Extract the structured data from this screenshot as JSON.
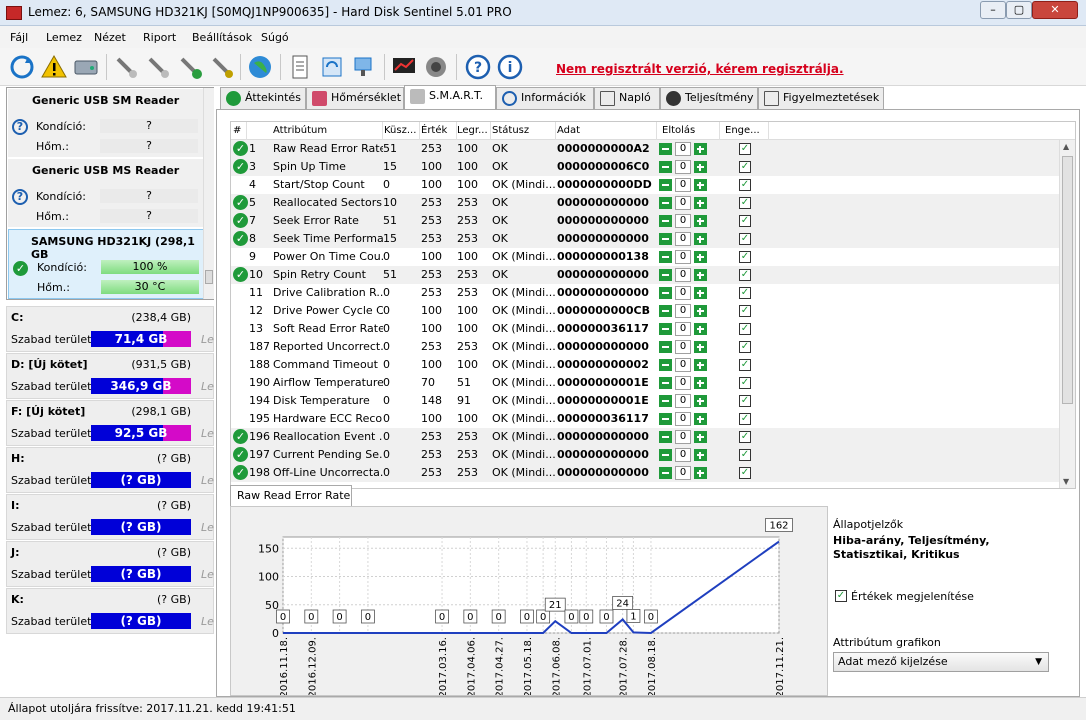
{
  "window": {
    "title": "Lemez: 6, SAMSUNG HD321KJ [S0MQJ1NP900635]  -  Hard Disk Sentinel 5.01 PRO",
    "min": "–",
    "max": "▢",
    "close": "✕"
  },
  "menu": [
    "Fájl",
    "Lemez",
    "Nézet",
    "Riport",
    "Beállítások",
    "Súgó"
  ],
  "register_link": "Nem regisztrált verzió, kérem regisztrálja.",
  "devices": [
    {
      "name": "Generic USB SM Reader",
      "condition_label": "Kondíció:",
      "condition": "?",
      "temp_label": "Hőm.:",
      "temp": "?"
    },
    {
      "name": "Generic USB MS Reader",
      "condition_label": "Kondíció:",
      "condition": "?",
      "temp_label": "Hőm.:",
      "temp": "?"
    },
    {
      "name": "SAMSUNG HD321KJ (298,1 GB",
      "condition_label": "Kondíció:",
      "condition": "100 %",
      "temp_label": "Hőm.:",
      "temp": "30 °C"
    }
  ],
  "partitions": [
    {
      "name": "C:",
      "size": "(238,4 GB)",
      "free_label": "Szabad terület",
      "free": "71,4 GB",
      "le": "Le"
    },
    {
      "name": "D: [Új kötet]",
      "size": "(931,5 GB)",
      "free_label": "Szabad terület",
      "free": "346,9 GB",
      "le": "Le"
    },
    {
      "name": "F: [Új kötet]",
      "size": "(298,1 GB)",
      "free_label": "Szabad terület",
      "free": "92,5 GB",
      "le": "Le"
    },
    {
      "name": "H:",
      "size": "(? GB)",
      "free_label": "Szabad terület",
      "free": "(? GB)",
      "le": "Le"
    },
    {
      "name": "I:",
      "size": "(? GB)",
      "free_label": "Szabad terület",
      "free": "(? GB)",
      "le": "Le"
    },
    {
      "name": "J:",
      "size": "(? GB)",
      "free_label": "Szabad terület",
      "free": "(? GB)",
      "le": "Le"
    },
    {
      "name": "K:",
      "size": "(? GB)",
      "free_label": "Szabad terület",
      "free": "(? GB)",
      "le": "Le"
    }
  ],
  "tabs": [
    "Áttekintés",
    "Hőmérséklet",
    "S.M.A.R.T.",
    "Információk",
    "Napló",
    "Teljesítmény",
    "Figyelmeztetések"
  ],
  "smart": {
    "headers": [
      "#",
      "Attribútum",
      "Küsz...",
      "Érték",
      "Legr...",
      "Státusz",
      "Adat",
      "Eltolás",
      "Enge..."
    ],
    "rows": [
      {
        "ok": true,
        "id": "1",
        "attr": "Raw Read Error Rate",
        "thr": "51",
        "val": "253",
        "worst": "100",
        "status": "OK",
        "data": "0000000000A2",
        "off": "0"
      },
      {
        "ok": true,
        "id": "3",
        "attr": "Spin Up Time",
        "thr": "15",
        "val": "100",
        "worst": "100",
        "status": "OK",
        "data": "0000000006C0",
        "off": "0"
      },
      {
        "ok": false,
        "id": "4",
        "attr": "Start/Stop Count",
        "thr": "0",
        "val": "100",
        "worst": "100",
        "status": "OK (Mindi...",
        "data": "0000000000DD",
        "off": "0"
      },
      {
        "ok": true,
        "id": "5",
        "attr": "Reallocated Sectors...",
        "thr": "10",
        "val": "253",
        "worst": "253",
        "status": "OK",
        "data": "000000000000",
        "off": "0"
      },
      {
        "ok": true,
        "id": "7",
        "attr": "Seek Error Rate",
        "thr": "51",
        "val": "253",
        "worst": "253",
        "status": "OK",
        "data": "000000000000",
        "off": "0"
      },
      {
        "ok": true,
        "id": "8",
        "attr": "Seek Time Performa...",
        "thr": "15",
        "val": "253",
        "worst": "253",
        "status": "OK",
        "data": "000000000000",
        "off": "0"
      },
      {
        "ok": false,
        "id": "9",
        "attr": "Power On Time Cou...",
        "thr": "0",
        "val": "100",
        "worst": "100",
        "status": "OK (Mindi...",
        "data": "000000000138",
        "off": "0"
      },
      {
        "ok": true,
        "id": "10",
        "attr": "Spin Retry Count",
        "thr": "51",
        "val": "253",
        "worst": "253",
        "status": "OK",
        "data": "000000000000",
        "off": "0"
      },
      {
        "ok": false,
        "id": "11",
        "attr": "Drive Calibration R...",
        "thr": "0",
        "val": "253",
        "worst": "253",
        "status": "OK (Mindi...",
        "data": "000000000000",
        "off": "0"
      },
      {
        "ok": false,
        "id": "12",
        "attr": "Drive Power Cycle C...",
        "thr": "0",
        "val": "100",
        "worst": "100",
        "status": "OK (Mindi...",
        "data": "0000000000CB",
        "off": "0"
      },
      {
        "ok": false,
        "id": "13",
        "attr": "Soft Read Error Rate",
        "thr": "0",
        "val": "100",
        "worst": "100",
        "status": "OK (Mindi...",
        "data": "000000036117",
        "off": "0"
      },
      {
        "ok": false,
        "id": "187",
        "attr": "Reported Uncorrect...",
        "thr": "0",
        "val": "253",
        "worst": "253",
        "status": "OK (Mindi...",
        "data": "000000000000",
        "off": "0"
      },
      {
        "ok": false,
        "id": "188",
        "attr": "Command Timeout",
        "thr": "0",
        "val": "100",
        "worst": "100",
        "status": "OK (Mindi...",
        "data": "000000000002",
        "off": "0"
      },
      {
        "ok": false,
        "id": "190",
        "attr": "Airflow Temperature",
        "thr": "0",
        "val": "70",
        "worst": "51",
        "status": "OK (Mindi...",
        "data": "00000000001E",
        "off": "0"
      },
      {
        "ok": false,
        "id": "194",
        "attr": "Disk Temperature",
        "thr": "0",
        "val": "148",
        "worst": "91",
        "status": "OK (Mindi...",
        "data": "00000000001E",
        "off": "0"
      },
      {
        "ok": false,
        "id": "195",
        "attr": "Hardware ECC Reco...",
        "thr": "0",
        "val": "100",
        "worst": "100",
        "status": "OK (Mindi...",
        "data": "000000036117",
        "off": "0"
      },
      {
        "ok": true,
        "id": "196",
        "attr": "Reallocation Event ...",
        "thr": "0",
        "val": "253",
        "worst": "253",
        "status": "OK (Mindi...",
        "data": "000000000000",
        "off": "0"
      },
      {
        "ok": true,
        "id": "197",
        "attr": "Current Pending Se...",
        "thr": "0",
        "val": "253",
        "worst": "253",
        "status": "OK (Mindi...",
        "data": "000000000000",
        "off": "0"
      },
      {
        "ok": true,
        "id": "198",
        "attr": "Off-Line Uncorrecta...",
        "thr": "0",
        "val": "253",
        "worst": "253",
        "status": "OK (Mindi...",
        "data": "000000000000",
        "off": "0"
      }
    ]
  },
  "graph": {
    "tab": "Raw Read Error Rate",
    "legend_title": "Állapotjelzők",
    "legend_text": "Hiba-arány, Teljesítmény, Statisztikai, Kritikus",
    "show_values_label": "Értékek megjelenítése",
    "attr_graph_label": "Attribútum grafikon",
    "dropdown": "Adat mező kijelzése"
  },
  "chart_data": {
    "type": "line",
    "title": "Raw Read Error Rate",
    "x": [
      "2016.11.18.",
      "2016.12.09.",
      "",
      "",
      "2017.03.16.",
      "2017.04.06.",
      "2017.04.27.",
      "2017.05.18.",
      "",
      "2017.06.08.",
      "",
      "2017.07.01.",
      "",
      "2017.07.28.",
      "",
      "2017.08.18.",
      "2017.11.21."
    ],
    "x_positions_days": [
      0,
      21,
      42,
      63,
      118,
      139,
      160,
      181,
      193,
      202,
      214,
      225,
      240,
      252,
      260,
      273,
      368
    ],
    "values": [
      0,
      0,
      0,
      0,
      0,
      0,
      0,
      0,
      0,
      21,
      0,
      0,
      0,
      24,
      1,
      0,
      162
    ],
    "yticks": [
      0,
      50,
      100,
      150
    ],
    "ylim": [
      0,
      170
    ],
    "grid": true,
    "series_color": "#1f3fbf"
  },
  "status": "Állapot utoljára frissítve: 2017.11.21. kedd 19:41:51"
}
